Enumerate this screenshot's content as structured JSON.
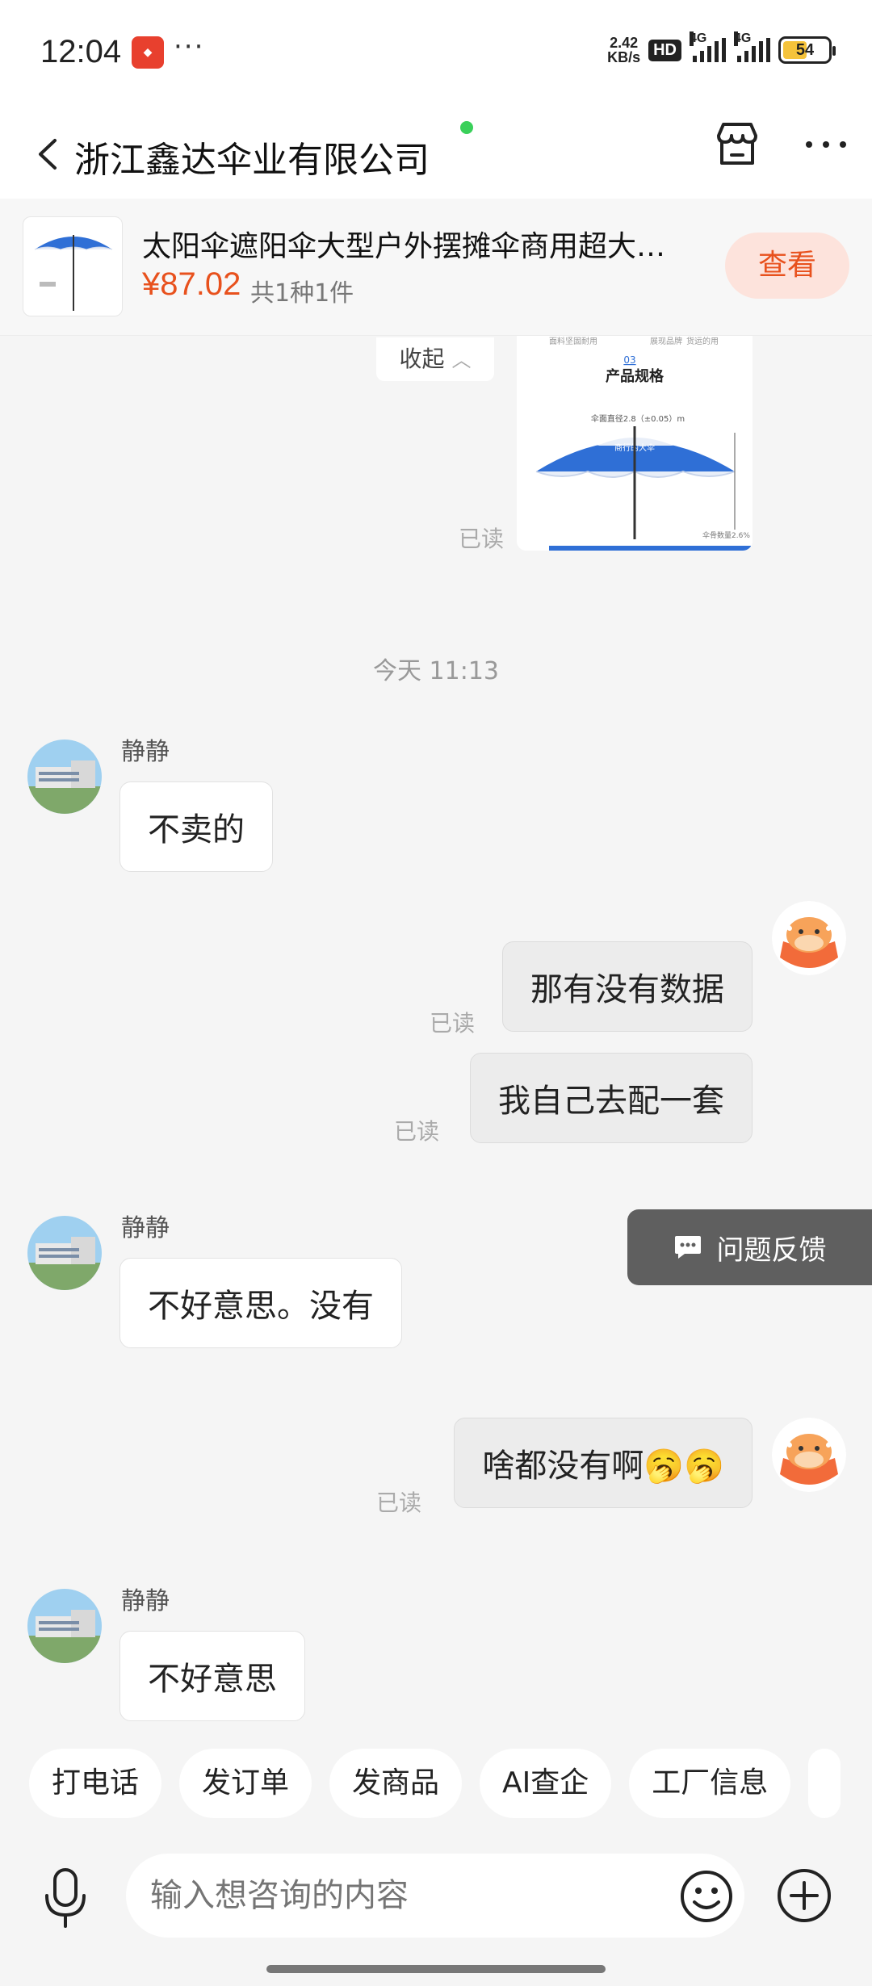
{
  "status_bar": {
    "time": "12:04",
    "dots": "···",
    "speed_value": "2.42",
    "speed_unit": "KB/s",
    "hd_label": "HD",
    "network_1": "4G",
    "network_2": "4G",
    "battery": "54"
  },
  "header": {
    "title": "浙江鑫达伞业有限公司"
  },
  "product": {
    "name": "太阳伞遮阳伞大型户外摆摊伞商用超大…",
    "price": "¥87.02",
    "count": "共1种1件",
    "view_label": "查看"
  },
  "chat": {
    "collapse_label": "收起",
    "image_msg": {
      "top_text_1": "面料坚固耐用",
      "top_text_2": "展现品牌",
      "top_text_3": "货运的用",
      "section_no": "03",
      "section_title": "产品规格",
      "spec_text": "伞面直径2.8（±0.05）m",
      "umbrella_text": "商行的大伞",
      "footer_text": "伞骨数量2.6%",
      "read": "已读"
    },
    "timestamp": "今天   11:13",
    "messages": [
      {
        "from": "in",
        "sender": "静静",
        "text": "不卖的"
      },
      {
        "from": "out",
        "text": "那有没有数据",
        "read": "已读"
      },
      {
        "from": "out",
        "text": "我自己去配一套",
        "read": "已读"
      },
      {
        "from": "in",
        "sender": "静静",
        "text": "不好意思。没有"
      },
      {
        "from": "out",
        "text": "啥都没有啊🥱🥱",
        "read": "已读"
      },
      {
        "from": "in",
        "sender": "静静",
        "text": "不好意思"
      }
    ],
    "feedback_label": "问题反馈"
  },
  "quick_actions": [
    "打电话",
    "发订单",
    "发商品",
    "AI查企",
    "工厂信息"
  ],
  "input": {
    "placeholder": "输入想咨询的内容"
  },
  "colors": {
    "accent": "#e8511d",
    "online": "#3ad05a",
    "feedback_bg": "#5f5f5f"
  }
}
